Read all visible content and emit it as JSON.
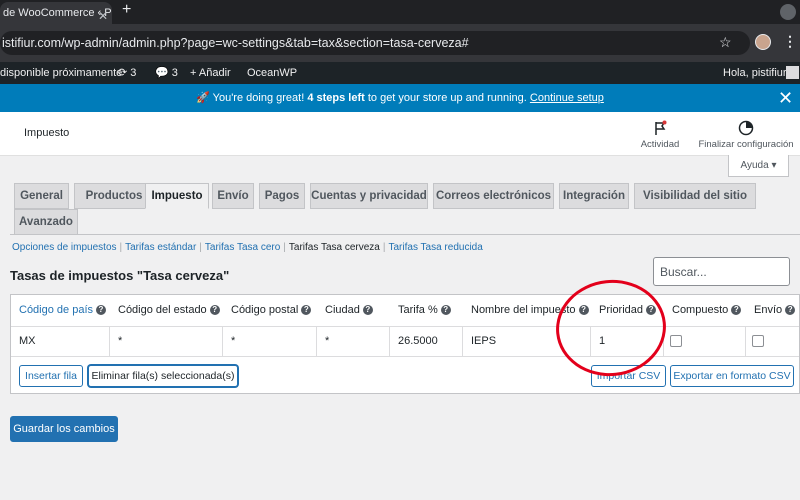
{
  "browser": {
    "tab_title": "de WooCommerce ‹ P",
    "url": "istifiur.com/wp-admin/admin.php?page=wc-settings&tab=tax&section=tasa-cerveza#"
  },
  "adminbar": {
    "update_notice": "disponible próximamente",
    "updates_count": "3",
    "comments_count": "3",
    "add_new": "Añadir",
    "theme": "OceanWP",
    "greeting": "Hola, pistifiur"
  },
  "notice": {
    "prefix": "🚀 You're doing great!",
    "steps": "4 steps left",
    "middle": "to get your store up and running.",
    "link": "Continue setup"
  },
  "header": {
    "title": "Impuesto",
    "activity": "Actividad",
    "finish_setup": "Finalizar configuración",
    "help": "Ayuda ▾"
  },
  "tabs": [
    "General",
    "Productos",
    "Impuesto",
    "Envío",
    "Pagos",
    "Cuentas y privacidad",
    "Correos electrónicos",
    "Integración",
    "Visibilidad del sitio",
    "Avanzado"
  ],
  "sections": {
    "options": "Opciones de impuestos",
    "standard": "Tarifas estándar",
    "zero": "Tarifas Tasa cero",
    "beer": "Tarifas Tasa cerveza",
    "reduced": "Tarifas Tasa reducida"
  },
  "rates": {
    "title": "Tasas de impuestos \"Tasa cerveza\"",
    "search_placeholder": "Buscar...",
    "columns": [
      "Código de país",
      "Código del estado",
      "Código postal",
      "Ciudad",
      "Tarifa %",
      "Nombre del impuesto",
      "Prioridad",
      "Compuesto",
      "Envío"
    ],
    "row": {
      "country": "MX",
      "state": "*",
      "postcode": "*",
      "city": "*",
      "rate": "26.5000",
      "name": "IEPS",
      "priority": "1",
      "compound": false,
      "shipping": false
    },
    "buttons": {
      "insert": "Insertar fila",
      "remove": "Eliminar fila(s) seleccionada(s)",
      "import": "Importar CSV",
      "export": "Exportar en formato CSV"
    }
  },
  "save_label": "Guardar los cambios",
  "colors": {
    "accent": "#2271b1",
    "notice": "#007cba",
    "annotation": "#e3001b"
  }
}
